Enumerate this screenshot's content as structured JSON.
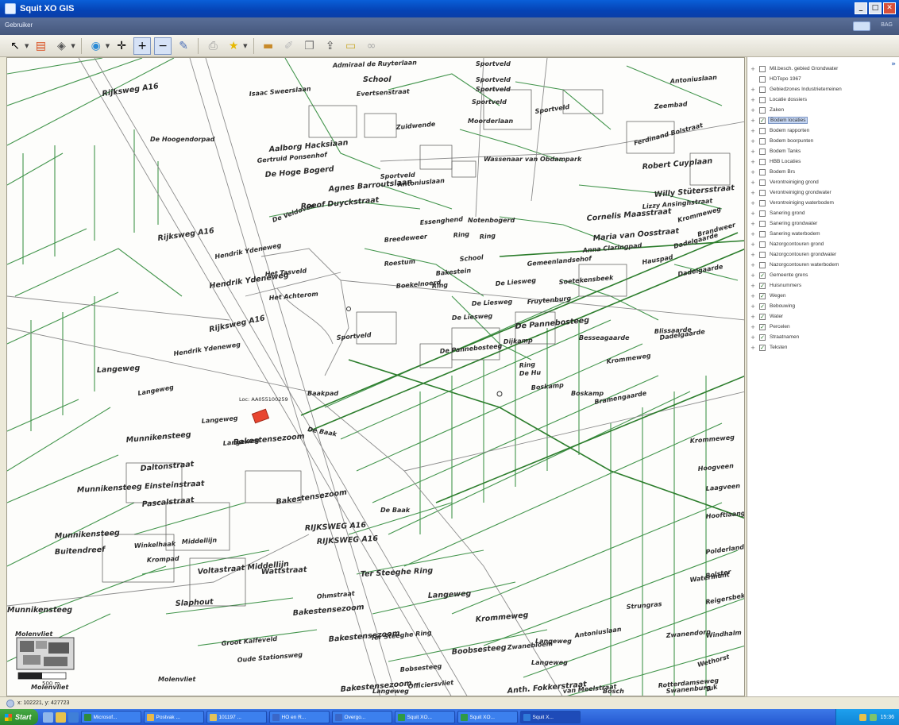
{
  "window": {
    "title": "Squit XO GIS",
    "menu": "Gebruiker",
    "side_label": "BAG"
  },
  "toolbar": {
    "tools": [
      "select-arrow-icon",
      "layers-icon",
      "identify-icon",
      "globe-icon",
      "pan-icon",
      "zoom-in-icon",
      "zoom-out-icon",
      "edit-icon",
      "print-icon",
      "star-icon",
      "ruler-icon",
      "pencil-icon",
      "copy-icon",
      "export-icon",
      "measure-icon",
      "binoculars-icon"
    ]
  },
  "map": {
    "location_label": "Loc: AA055100259",
    "scale_label": "500 m",
    "street_labels": [
      "Admiraal de Ruyterlaan",
      "School",
      "Sportveld",
      "Rijksweg A16",
      "Isaac Sweerslaan",
      "Evertsenstraat",
      "Sportveld",
      "De Hoogendorpad",
      "Aalborg Hacksiaan",
      "Gertruid Ponsenhof",
      "De Hoge Bogerd",
      "Agnes Barroutslaan",
      "Antoniuslaan",
      "Roeof Duyckstraat",
      "Rijksweg A16",
      "De Veldoven",
      "Hendrik Ydeneweg",
      "Het Tasveld",
      "Hendrik Ydeneweg",
      "Het Achterom",
      "Rijksweg A16",
      "Hendrik Ydeneweg",
      "Langeweg",
      "Langeweg",
      "Langeweg",
      "Munnikensteeg",
      "Langeweg",
      "Daltonstraat",
      "Munnikensteeg Einsteinstraat",
      "Pascalstraat",
      "Munnikensteeg",
      "Buitendreef",
      "Winkelhaak",
      "Krompad",
      "Middellijn",
      "Voltastraat Middellijn",
      "Wattstraat",
      "Slaphout",
      "Munnikensteeg",
      "Molenvliet",
      "Molenvliet",
      "Molenvliet",
      "Molenvliet",
      "Groot Kalfeveld",
      "Oude Stationsweg",
      "Bakestensezoom",
      "Bakestensezoom",
      "Bakestensezoom",
      "Bakestensezoom",
      "Bakestensezoom",
      "Officiersvliet",
      "Boobsesteeg",
      "Bobsesteeg",
      "De Baak",
      "Baakpad",
      "De Baak",
      "RIJKSWEG A16",
      "RIJKSWEG A16",
      "Ohmstraat",
      "Ter Steeghe Ring",
      "Ter Steeghe Ring",
      "Langeweg",
      "Langeweg",
      "Krommeweg",
      "Zwanebloem",
      "Langeweg",
      "Anth. Fokkerstraat",
      "van Meelstraat",
      "Bosch",
      "Sportveld",
      "Sportveld",
      "Sportveld",
      "Antoniuslaan",
      "Zeembad",
      "Ferdinand Bolstraat",
      "Robert Cuyplaan",
      "Willy Stütersstraat",
      "Lizzy Ansinghstraat",
      "Cornelis Maasstraat",
      "Krommeweg",
      "Brandweer",
      "Maria van Oosstraat",
      "Anna Claringpad",
      "Dadelgaarde",
      "Hauspad",
      "Dadelgaarde",
      "Notenbogerd",
      "Essenghend",
      "Breedeweer",
      "Ring",
      "Ring",
      "School",
      "Bakestein",
      "Ring",
      "Roestum",
      "Boekelnoerd",
      "De Liesweg",
      "Gemeenlandsehof",
      "Soetekensbeek",
      "De Liesweg",
      "Fruytenburg",
      "De Liesweg",
      "De Pannebosteeg",
      "Ring",
      "Dijkamp",
      "De Pannebosteeg",
      "De Hu",
      "Boskamp",
      "Boskamp",
      "Krommeweg",
      "Besseagaarde",
      "Blissaarde",
      "Dadelgaarde",
      "Bramengaarde",
      "Krommeweg",
      "Hoogveen",
      "Laagveen",
      "Hooftlaange",
      "Polderland",
      "Bolster",
      "Reigersbek",
      "Watermunt",
      "Strungras",
      "Windhalm",
      "Wethorst",
      "Swanenburg",
      "Tuk",
      "Rotterdamseweg",
      "Zwanendorp",
      "Moorderlaan",
      "Sportveld",
      "Zuidwende",
      "Wassenaar van Obdampark",
      "Sportveld",
      "Antoniuslaan",
      "Langeweg"
    ]
  },
  "layers": [
    {
      "name": "Mil.besch. gebied Grondwater",
      "checked": false,
      "expandable": true
    },
    {
      "name": "HDTopo 1967",
      "checked": false,
      "expandable": false
    },
    {
      "name": "Gebiedzones Industrieterreinen",
      "checked": false,
      "expandable": true
    },
    {
      "name": "Locatie dossiers",
      "checked": false,
      "expandable": true
    },
    {
      "name": "Zaken",
      "checked": false,
      "expandable": true
    },
    {
      "name": "Bodem locaties",
      "checked": true,
      "expandable": true,
      "selected": true
    },
    {
      "name": "Bodem rapporten",
      "checked": false,
      "expandable": true
    },
    {
      "name": "Bodem boorpunten",
      "checked": false,
      "expandable": true
    },
    {
      "name": "Bodem Tanks",
      "checked": false,
      "expandable": true
    },
    {
      "name": "HBB Locaties",
      "checked": false,
      "expandable": true
    },
    {
      "name": "Bodem Brs",
      "checked": false,
      "expandable": true
    },
    {
      "name": "Verontreiniging grond",
      "checked": false,
      "expandable": true
    },
    {
      "name": "Verontreiniging grondwater",
      "checked": false,
      "expandable": true
    },
    {
      "name": "Verontreiniging waterbodem",
      "checked": false,
      "expandable": true
    },
    {
      "name": "Sanering grond",
      "checked": false,
      "expandable": true
    },
    {
      "name": "Sanering grondwater",
      "checked": false,
      "expandable": true
    },
    {
      "name": "Sanering waterbodem",
      "checked": false,
      "expandable": true
    },
    {
      "name": "Nazorgcontouren grond",
      "checked": false,
      "expandable": true
    },
    {
      "name": "Nazorgcontouren grondwater",
      "checked": false,
      "expandable": true
    },
    {
      "name": "Nazorgcontouren waterbodem",
      "checked": false,
      "expandable": true
    },
    {
      "name": "Gemeente grens",
      "checked": true,
      "expandable": true
    },
    {
      "name": "Huisnummers",
      "checked": true,
      "expandable": true
    },
    {
      "name": "Wegen",
      "checked": true,
      "expandable": true
    },
    {
      "name": "Bebouwing",
      "checked": true,
      "expandable": true
    },
    {
      "name": "Water",
      "checked": true,
      "expandable": true
    },
    {
      "name": "Percelen",
      "checked": true,
      "expandable": true
    },
    {
      "name": "Straatnamen",
      "checked": true,
      "expandable": true
    },
    {
      "name": "Teksten",
      "checked": true,
      "expandable": true
    }
  ],
  "statusbar": {
    "coords": "x: 102221, y: 427723"
  },
  "taskbar": {
    "start": "Start",
    "tasks": [
      {
        "label": "Microsof...",
        "color": "#2f8a3d"
      },
      {
        "label": "Postvak ...",
        "color": "#e7b84a"
      },
      {
        "label": "101197 ...",
        "color": "#e2c25a"
      },
      {
        "label": "HO en R...",
        "color": "#3a67c8"
      },
      {
        "label": "Overgo...",
        "color": "#3a67c8"
      },
      {
        "label": "Squit XO...",
        "color": "#2f9a45"
      },
      {
        "label": "Squit XO...",
        "color": "#2f9a45"
      },
      {
        "label": "Squit X...",
        "color": "#2f7ad8"
      }
    ],
    "clock": "15:36"
  },
  "colors": {
    "parcel_line": "#2f8a3a",
    "road_line": "#7d7d7d",
    "highlight": "#e8452f",
    "selected_row": "#c5d6f3"
  }
}
